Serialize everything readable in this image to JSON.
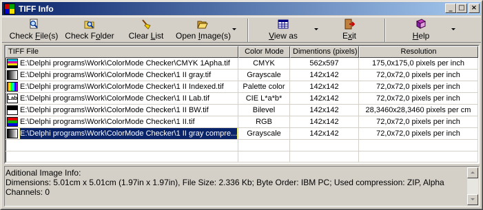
{
  "window": {
    "title": "TIFF Info",
    "controls": {
      "minimize": "_",
      "maximize": "□",
      "close": "×"
    }
  },
  "toolbar": {
    "check_files": {
      "prefix": "Check ",
      "key": "F",
      "suffix": "ile(s)",
      "icon": "magnifier-file-icon"
    },
    "check_folder": {
      "prefix": "Check F",
      "key": "o",
      "suffix": "lder",
      "icon": "magnifier-folder-icon"
    },
    "clear_list": {
      "prefix": "Clear ",
      "key": "L",
      "suffix": "ist",
      "icon": "broom-icon"
    },
    "open_images": {
      "prefix": "Open ",
      "key": "I",
      "suffix": "mage(s)",
      "icon": "folder-open-icon"
    },
    "view_as": {
      "prefix": "",
      "key": "V",
      "suffix": "iew as",
      "icon": "grid-view-icon"
    },
    "exit": {
      "prefix": "E",
      "key": "x",
      "suffix": "it",
      "icon": "exit-door-icon"
    },
    "help": {
      "prefix": "",
      "key": "H",
      "suffix": "elp",
      "icon": "help-book-icon"
    }
  },
  "table": {
    "columns": [
      "TIFF File",
      "Color Mode",
      "Dimentions (pixels)",
      "Resolution"
    ],
    "rows": [
      {
        "file": "E:\\Delphi programs\\Work\\ColorMode Checker\\CMYK 1Apha.tif",
        "mode": "CMYK",
        "dims": "562x597",
        "res": "175,0x175,0 pixels per inch",
        "icon": "cmyk-icon"
      },
      {
        "file": "E:\\Delphi programs\\Work\\ColorMode Checker\\1 II gray.tif",
        "mode": "Grayscale",
        "dims": "142x142",
        "res": "72,0x72,0 pixels per inch",
        "icon": "grayscale-icon"
      },
      {
        "file": "E:\\Delphi programs\\Work\\ColorMode Checker\\1 II Indexed.tif",
        "mode": "Palette color",
        "dims": "142x142",
        "res": "72,0x72,0 pixels per inch",
        "icon": "palette-icon"
      },
      {
        "file": "E:\\Delphi programs\\Work\\ColorMode Checker\\1 II Lab.tif",
        "mode": "CIE L*a*b*",
        "dims": "142x142",
        "res": "72,0x72,0 pixels per inch",
        "icon": "lab-icon"
      },
      {
        "file": "E:\\Delphi programs\\Work\\ColorMode Checker\\1 II BW.tif",
        "mode": "Bilevel",
        "dims": "142x142",
        "res": "28,3460x28,3460 pixels per cm",
        "icon": "bilevel-icon"
      },
      {
        "file": "E:\\Delphi programs\\Work\\ColorMode Checker\\1 II.tif",
        "mode": "RGB",
        "dims": "142x142",
        "res": "72,0x72,0 pixels per inch",
        "icon": "rgb-icon"
      },
      {
        "file": "E:\\Delphi programs\\Work\\ColorMode Checker\\1 II gray compre...",
        "mode": "Grayscale",
        "dims": "142x142",
        "res": "72,0x72,0 pixels per inch",
        "icon": "grayscale-icon",
        "selected": true
      }
    ]
  },
  "info": {
    "heading": "Aditional Image Info:",
    "details": "Dimensions: 5.01cm x 5.01cm (1.97in x 1.97in), File Size: 2.336 Kb; Byte Order: IBM PC; Used compression: ZIP, Alpha Channels: 0"
  },
  "colors": {
    "title_start": "#0a246a",
    "title_end": "#a6caf0",
    "selection": "#0a246a",
    "face": "#d4d0c8"
  }
}
